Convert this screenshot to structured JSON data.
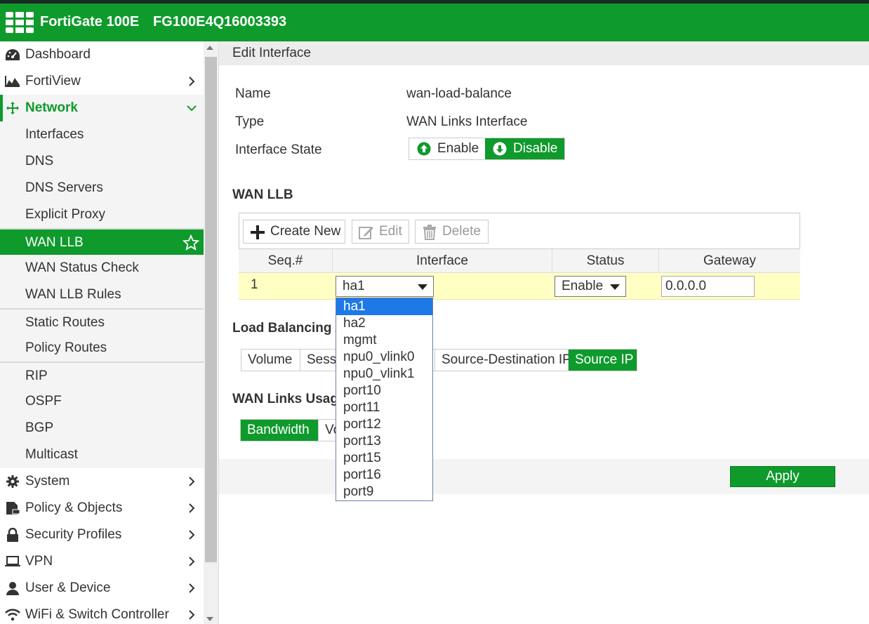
{
  "header": {
    "model": "FortiGate 100E",
    "serial": "FG100E4Q16003393"
  },
  "sidebar": {
    "items": [
      {
        "label": "Dashboard",
        "icon": "dashboard-icon",
        "chevron": false
      },
      {
        "label": "FortiView",
        "icon": "fortiview-icon",
        "chevron": "right"
      },
      {
        "label": "Network",
        "icon": "network-move-icon",
        "chevron": "down"
      },
      {
        "label": "Interfaces"
      },
      {
        "label": "DNS"
      },
      {
        "label": "DNS Servers"
      },
      {
        "label": "Explicit Proxy"
      },
      {
        "label": "WAN LLB",
        "active": true
      },
      {
        "label": "WAN Status Check"
      },
      {
        "label": "WAN LLB Rules"
      },
      {
        "label": "Static Routes"
      },
      {
        "label": "Policy Routes"
      },
      {
        "label": "RIP"
      },
      {
        "label": "OSPF"
      },
      {
        "label": "BGP"
      },
      {
        "label": "Multicast"
      },
      {
        "label": "System",
        "icon": "gear-icon",
        "chevron": "right"
      },
      {
        "label": "Policy & Objects",
        "icon": "policy-document-icon",
        "chevron": "right"
      },
      {
        "label": "Security Profiles",
        "icon": "lock-icon",
        "chevron": "right"
      },
      {
        "label": "VPN",
        "icon": "laptop-icon",
        "chevron": "right"
      },
      {
        "label": "User & Device",
        "icon": "user-icon",
        "chevron": "right"
      },
      {
        "label": "WiFi & Switch Controller",
        "icon": "wifi-icon",
        "chevron": "right"
      }
    ]
  },
  "page": {
    "title": "Edit Interface",
    "name_label": "Name",
    "name_value": "wan-load-balance",
    "type_label": "Type",
    "type_value": "WAN Links Interface",
    "state_label": "Interface State",
    "state_enable": "Enable",
    "state_disable": "Disable",
    "state_selected": "Disable"
  },
  "wanllb": {
    "section_title": "WAN LLB",
    "toolbar": {
      "create_new": "Create New",
      "edit": "Edit",
      "delete": "Delete"
    },
    "columns": [
      "Seq.#",
      "Interface",
      "Status",
      "Gateway"
    ],
    "rows": [
      {
        "seq": "1",
        "interface": "ha1",
        "status": "Enable",
        "gateway": "0.0.0.0"
      }
    ]
  },
  "load_balancing": {
    "title": "Load Balancing Al",
    "options": [
      "Volume",
      "Sessi",
      "Source-Destination IP",
      "Source IP"
    ],
    "selected": "Source IP"
  },
  "usage": {
    "title": "WAN Links Usage",
    "options": [
      "Bandwidth",
      "Vo"
    ],
    "selected": "Bandwidth"
  },
  "footer": {
    "apply": "Apply"
  },
  "dropdown": {
    "options": [
      "ha1",
      "ha2",
      "mgmt",
      "npu0_vlink0",
      "npu0_vlink1",
      "port10",
      "port11",
      "port12",
      "port13",
      "port15",
      "port16",
      "port9"
    ],
    "selected": "ha1"
  },
  "colors": {
    "brand_green": "#0f9a2c",
    "selection_blue": "#1e78e6",
    "row_highlight": "#ffffc4"
  }
}
